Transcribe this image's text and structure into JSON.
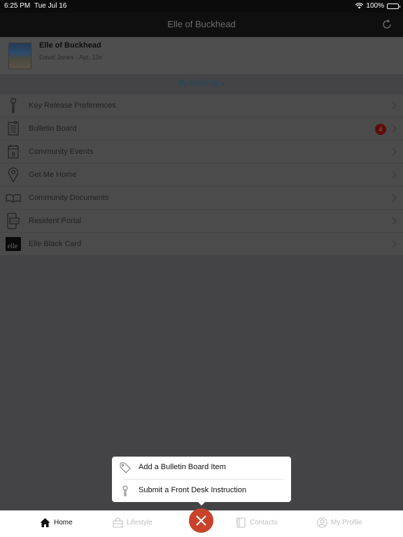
{
  "status_bar": {
    "time": "6:25 PM",
    "date": "Tue Jul 16",
    "battery": "100%"
  },
  "nav": {
    "title": "Elle of Buckhead",
    "refresh_icon": "refresh-icon"
  },
  "header_card": {
    "title": "Elle of Buckhead",
    "subtitle": "David Jones - Apt. 13x"
  },
  "section": {
    "label": "My Building",
    "arrow": "▲"
  },
  "menu": [
    {
      "label": "Key Release Preferences",
      "icon": "key-icon"
    },
    {
      "label": "Bulletin Board",
      "icon": "bulletin-icon",
      "badge": "4"
    },
    {
      "label": "Community Events",
      "icon": "calendar-icon",
      "calendar_day": "8"
    },
    {
      "label": "Get Me Home",
      "icon": "location-pin-icon"
    },
    {
      "label": "Community Documents",
      "icon": "book-icon"
    },
    {
      "label": "Resident Portal",
      "icon": "phone-card-icon"
    },
    {
      "label": "Elle Black Card",
      "icon": "elle-card-icon",
      "logo_text": "elle"
    }
  ],
  "popover": {
    "items": [
      {
        "label": "Add a Bulletin Board Item",
        "icon": "tag-icon"
      },
      {
        "label": "Submit a Front Desk Instruction",
        "icon": "key-icon"
      }
    ]
  },
  "tabbar": {
    "tabs": [
      {
        "label": "Home",
        "icon": "home-icon",
        "active": true
      },
      {
        "label": "Lifestyle",
        "icon": "bag-icon",
        "active": false
      },
      {
        "label": "Contacts",
        "icon": "contacts-book-icon",
        "active": false
      },
      {
        "label": "My Profile",
        "icon": "profile-icon",
        "active": false
      }
    ],
    "fab_icon": "close-icon"
  },
  "colors": {
    "accent": "#c8432a",
    "badge": "#5a0e0b",
    "section_link": "#1f4860"
  }
}
